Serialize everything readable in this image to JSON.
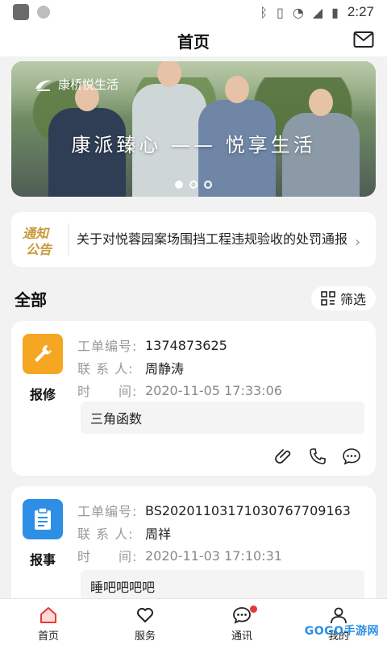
{
  "status_bar": {
    "time": "2:27"
  },
  "header": {
    "title": "首页"
  },
  "banner": {
    "brand": "康桥悦生活",
    "slogan": "康派臻心 —— 悦享生活",
    "active_slide": 1,
    "slide_count": 3
  },
  "notice": {
    "badge_line1": "通知",
    "badge_line2": "公告",
    "text": "关于对悦蓉园案场围挡工程违规验收的处罚通报"
  },
  "section": {
    "title": "全部",
    "filter_label": "筛选"
  },
  "orders": [
    {
      "type_label": "报修",
      "type_color": "#f5a623",
      "order_no_label": "工单编号:",
      "order_no": "1374873625",
      "contact_label": "联 系 人:",
      "contact": "周静涛",
      "time_label": "时　　间:",
      "time": "2020-11-05 17:33:06",
      "description": "三角函数"
    },
    {
      "type_label": "报事",
      "type_color": "#2d8ee6",
      "order_no_label": "工单编号:",
      "order_no": "BS20201103171030767709163",
      "contact_label": "联 系 人:",
      "contact": "周祥",
      "time_label": "时　　间:",
      "time": "2020-11-03 17:10:31",
      "description": "睡吧吧吧吧"
    }
  ],
  "tabbar": {
    "items": [
      {
        "label": "首页",
        "icon": "home-icon"
      },
      {
        "label": "服务",
        "icon": "heart-icon"
      },
      {
        "label": "通讯",
        "icon": "chat-icon"
      },
      {
        "label": "我的",
        "icon": "person-icon"
      }
    ]
  },
  "watermark": "GOGO手游网"
}
